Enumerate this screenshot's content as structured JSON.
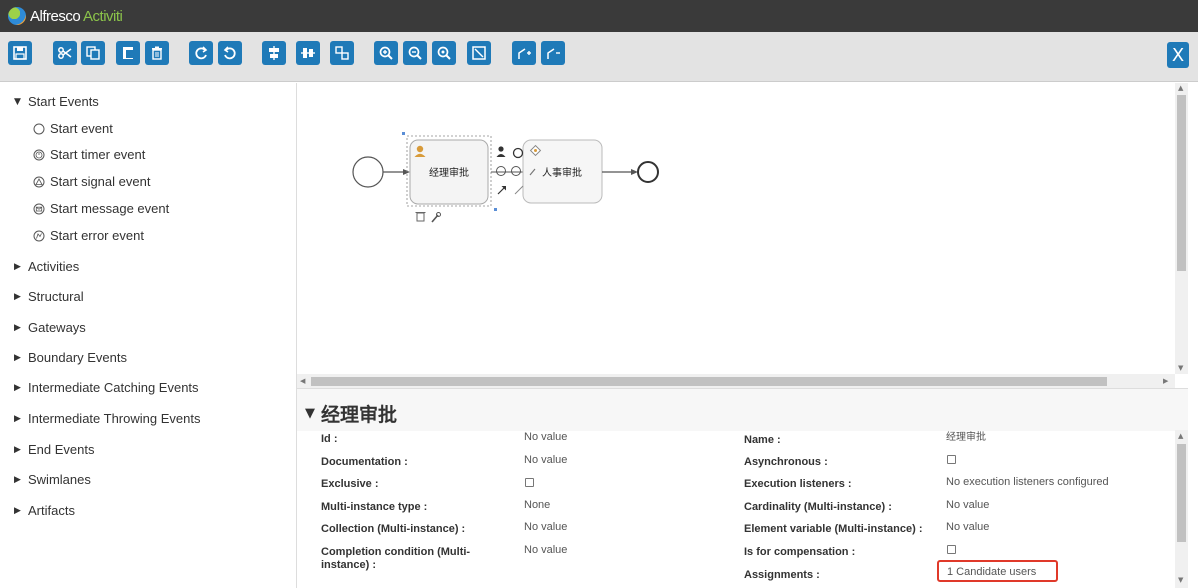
{
  "header": {
    "brand_part1": "Alfresco",
    "brand_part2": " Activiti"
  },
  "toolbar": {
    "buttons": [
      "save",
      "cut",
      "copy",
      "paste",
      "delete",
      "redo",
      "undo",
      "align-horizontal",
      "align-vertical",
      "same-size",
      "zoom-in",
      "zoom-out",
      "zoom-actual",
      "zoom-fit",
      "bendpoint-add",
      "bendpoint-remove"
    ],
    "close_label": "X"
  },
  "palette": {
    "start_events": {
      "label": "Start Events",
      "items": [
        "Start event",
        "Start timer event",
        "Start signal event",
        "Start message event",
        "Start error event"
      ]
    },
    "groups": [
      "Activities",
      "Structural",
      "Gateways",
      "Boundary Events",
      "Intermediate Catching Events",
      "Intermediate Throwing Events",
      "End Events",
      "Swimlanes",
      "Artifacts"
    ]
  },
  "canvas": {
    "task1_label": "经理审批",
    "task2_label": "人事审批"
  },
  "properties": {
    "title": "经理审批",
    "left": [
      {
        "label": "Id :",
        "value": "No value"
      },
      {
        "label": "Documentation :",
        "value": "No value"
      },
      {
        "label": "Exclusive :",
        "value": ""
      },
      {
        "label": "Multi-instance type :",
        "value": "None"
      },
      {
        "label": "Collection (Multi-instance) :",
        "value": "No value"
      },
      {
        "label": "Completion condition (Multi-instance) :",
        "value": "No value"
      }
    ],
    "right": [
      {
        "label": "Name :",
        "value": "经理审批"
      },
      {
        "label": "Asynchronous :",
        "value": ""
      },
      {
        "label": "Execution listeners :",
        "value": "No execution listeners configured"
      },
      {
        "label": "Cardinality (Multi-instance) :",
        "value": "No value"
      },
      {
        "label": "Element variable (Multi-instance) :",
        "value": "No value"
      },
      {
        "label": "Is for compensation :",
        "value": ""
      },
      {
        "label": "Assignments :",
        "value": "1 Candidate users"
      }
    ]
  },
  "colors": {
    "accent": "#1f7ab8",
    "highlight": "#e0392a",
    "header_bg": "#3a3a3a"
  }
}
